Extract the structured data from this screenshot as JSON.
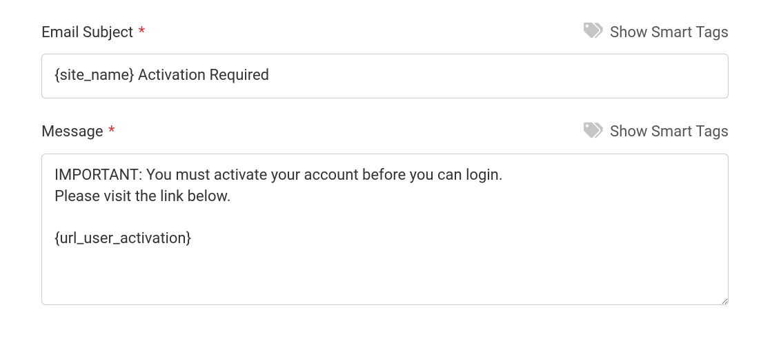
{
  "fields": {
    "subject": {
      "label": "Email Subject",
      "value": "{site_name} Activation Required",
      "smart_tags_label": "Show Smart Tags"
    },
    "message": {
      "label": "Message",
      "value": "IMPORTANT: You must activate your account before you can login.\nPlease visit the link below.\n\n{url_user_activation}",
      "smart_tags_label": "Show Smart Tags"
    }
  }
}
